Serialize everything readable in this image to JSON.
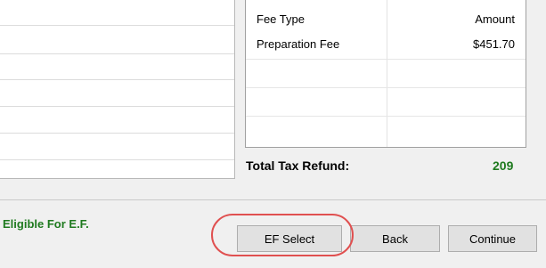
{
  "fee_table": {
    "header_type": "Fee Type",
    "header_amount": "Amount",
    "rows": [
      {
        "type": "Preparation Fee",
        "amount": "$451.70"
      }
    ]
  },
  "refund": {
    "label": "Total Tax Refund:",
    "value": "209"
  },
  "status": {
    "eligible_text": "Eligible For E.F."
  },
  "buttons": {
    "ef_select": "EF Select",
    "back": "Back",
    "continue": "Continue"
  },
  "colors": {
    "green": "#1f7a1f",
    "highlight": "#e05050"
  }
}
